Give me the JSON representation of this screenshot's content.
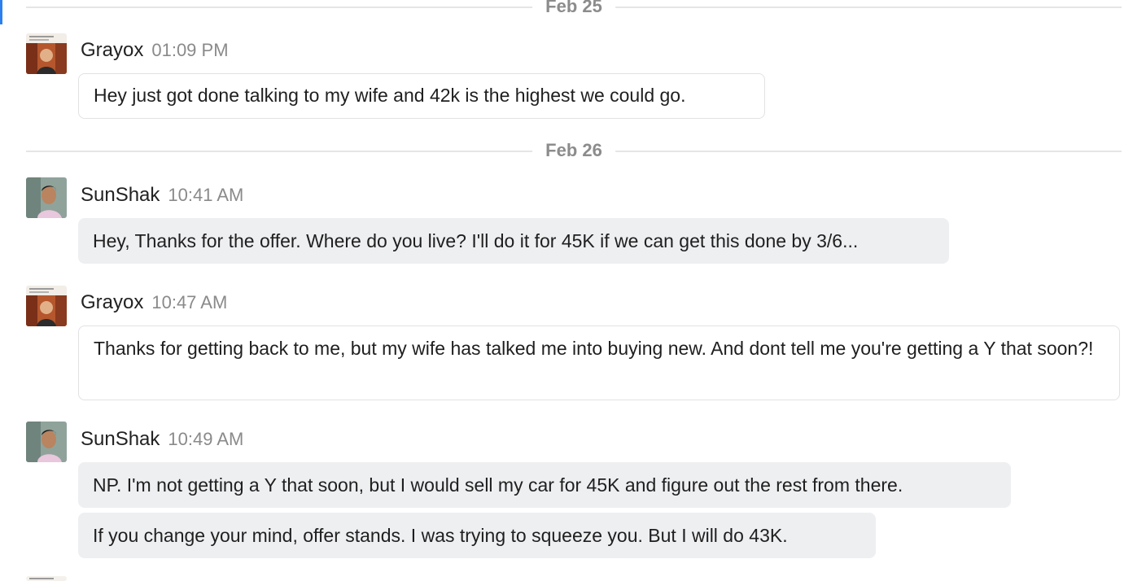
{
  "dividers": [
    {
      "date": "Feb 25"
    },
    {
      "date": "Feb 26"
    }
  ],
  "messages": [
    {
      "author": "Grayox",
      "time": "01:09 PM",
      "text": "Hey just got done talking to my wife and 42k is the highest we could go."
    },
    {
      "author": "SunShak",
      "time": "10:41 AM",
      "text": "Hey, Thanks for the offer. Where do you live? I'll do it for 45K if we can get this done by 3/6..."
    },
    {
      "author": "Grayox",
      "time": "10:47 AM",
      "text": "Thanks for getting back to me, but my wife has talked me into buying new. And dont tell me you're getting a Y that soon?!"
    },
    {
      "author": "SunShak",
      "time": "10:49 AM",
      "text": "NP. I'm not getting a Y that soon, but I would sell my car for 45K and figure out the rest from there.",
      "text2": "If you change your mind, offer stands. I was trying to squeeze you. But I will do 43K."
    }
  ],
  "icons": {
    "grayox_avatar": "grayox-avatar",
    "sunshak_avatar": "sunshak-avatar"
  },
  "colors": {
    "accent": "#2d7ff0",
    "incoming_bubble": "#eeeff1",
    "outgoing_border": "#e2e2e2",
    "date_text": "#8c8c8c"
  }
}
